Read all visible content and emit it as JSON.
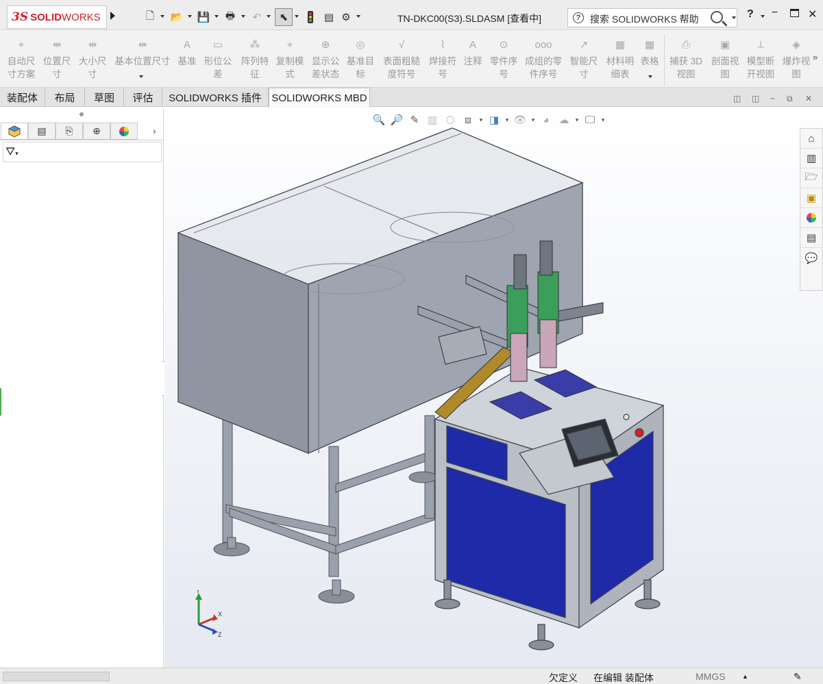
{
  "app": {
    "logo_ds": "3S",
    "logo_solid": "SOLID",
    "logo_works": "WORKS",
    "document_title": "TN-DKC00(S3).SLDASM [查看中]",
    "search_placeholder": "搜索 SOLIDWORKS 帮助",
    "help_label": "?",
    "minimize_icon": "minimize-icon",
    "maximize_icon": "maximize-icon",
    "close_icon": "close-icon"
  },
  "quick_access": [
    {
      "name": "new-document-icon",
      "glyph": "🗋"
    },
    {
      "name": "open-document-icon",
      "glyph": "📂"
    },
    {
      "name": "save-icon",
      "glyph": "💾"
    },
    {
      "name": "print-icon",
      "glyph": "🖶"
    },
    {
      "name": "undo-icon",
      "glyph": "↶"
    },
    {
      "name": "select-icon",
      "glyph": "⬉"
    },
    {
      "name": "rebuild-icon",
      "glyph": "🚦"
    },
    {
      "name": "file-properties-icon",
      "glyph": "▤"
    },
    {
      "name": "options-gear-icon",
      "glyph": "⚙"
    }
  ],
  "ribbon": {
    "items": [
      {
        "label": "自动尺\n寸方案",
        "icon": "auto-dimension-icon"
      },
      {
        "label": "位置尺\n寸",
        "icon": "location-dimension-icon"
      },
      {
        "label": "大小尺\n寸",
        "icon": "size-dimension-icon"
      },
      {
        "label": "基本位置尺寸",
        "icon": "basic-location-dimension-icon"
      },
      {
        "label": "基准",
        "icon": "datum-icon"
      },
      {
        "label": "形位公\n差",
        "icon": "geometric-tolerance-icon"
      },
      {
        "label": "阵列特\n征",
        "icon": "pattern-feature-icon"
      },
      {
        "label": "复制模\n式",
        "icon": "copy-scheme-icon"
      },
      {
        "label": "显示公\n差状态",
        "icon": "show-tolerance-status-icon"
      },
      {
        "label": "基准目\n标",
        "icon": "datum-target-icon"
      },
      {
        "label": "表面粗糙\n度符号",
        "icon": "surface-finish-icon"
      },
      {
        "label": "焊接符\n号",
        "icon": "weld-symbol-icon"
      },
      {
        "label": "注释",
        "icon": "note-icon"
      },
      {
        "label": "零件序\n号",
        "icon": "balloon-icon"
      },
      {
        "label": "成组的零\n件序号",
        "icon": "stacked-balloon-icon"
      },
      {
        "label": "智能尺\n寸",
        "icon": "smart-dimension-icon"
      },
      {
        "label": "材料明\n细表",
        "icon": "bill-of-materials-icon"
      },
      {
        "label": "表格",
        "icon": "table-icon"
      },
      {
        "label": "捕获 3D\n视图",
        "icon": "capture-3d-view-icon"
      },
      {
        "label": "剖面视\n图",
        "icon": "section-view-icon"
      },
      {
        "label": "模型断\n开视图",
        "icon": "model-break-view-icon"
      },
      {
        "label": "爆炸视\n图",
        "icon": "exploded-view-icon"
      }
    ],
    "more": "»"
  },
  "tabs": [
    {
      "label": "装配体"
    },
    {
      "label": "布局"
    },
    {
      "label": "草图"
    },
    {
      "label": "评估"
    },
    {
      "label": "SOLIDWORKS 插件"
    },
    {
      "label": "SOLIDWORKS MBD",
      "active": true
    }
  ],
  "left_panel": {
    "tabs": [
      {
        "name": "feature-manager-icon",
        "glyph": "◆"
      },
      {
        "name": "property-manager-icon",
        "glyph": "▤"
      },
      {
        "name": "configuration-manager-icon",
        "glyph": "⎘"
      },
      {
        "name": "dimxpert-manager-icon",
        "glyph": "⊕"
      },
      {
        "name": "display-manager-icon",
        "glyph": "◕"
      }
    ],
    "more": "›",
    "filter_icon": "filter-icon"
  },
  "viewport": {
    "hud_icons": [
      "zoom-to-fit-icon",
      "zoom-to-area-icon",
      "previous-view-icon",
      "section-view-icon",
      "dynamic-annotation-icon",
      "view-orientation-icon",
      "display-style-icon",
      "hide-show-items-icon",
      "edit-appearance-icon",
      "apply-scene-icon",
      "view-settings-icon"
    ],
    "task_pane": [
      "solidworks-resources-icon",
      "design-library-icon",
      "file-explorer-icon",
      "view-palette-icon",
      "appearances-icon",
      "custom-properties-icon",
      "forum-icon"
    ],
    "triad_labels": {
      "y": "Y",
      "x": "X",
      "z": "Z"
    }
  },
  "status_bar": {
    "under_defined": "欠定义",
    "editing": "在编辑 装配体",
    "units": "MMGS",
    "units_arrow": "▲"
  }
}
